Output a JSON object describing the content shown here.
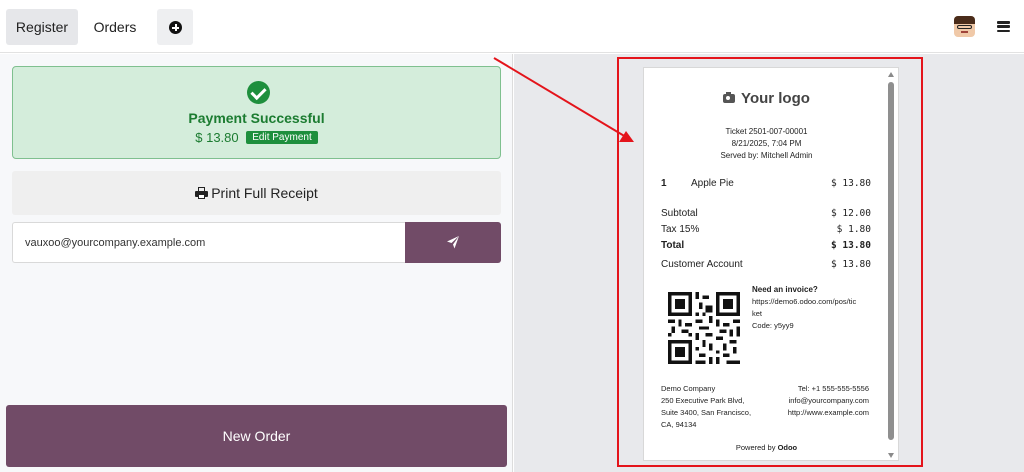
{
  "topbar": {
    "tabs": [
      {
        "label": "Register",
        "active": true
      },
      {
        "label": "Orders",
        "active": false
      }
    ],
    "add_icon": "plus-circle-icon",
    "avatar_icon": "user-avatar-icon",
    "menu_icon": "hamburger-menu-icon"
  },
  "payment": {
    "title": "Payment Successful",
    "amount": "$ 13.80",
    "edit_label": "Edit Payment",
    "status_color": "#1e8f3d"
  },
  "print": {
    "label": "Print Full Receipt"
  },
  "email": {
    "value": "vauxoo@yourcompany.example.com"
  },
  "new_order": {
    "label": "New Order"
  },
  "receipt": {
    "logo_text": "Your logo",
    "ticket": "Ticket 2501-007-00001",
    "datetime": "8/21/2025, 7:04 PM",
    "served_by": "Served by: Mitchell Admin",
    "lines": [
      {
        "qty": "1",
        "name": "Apple Pie",
        "price": "$ 13.80"
      }
    ],
    "subtotal_label": "Subtotal",
    "subtotal": "$ 12.00",
    "tax_label": "Tax 15%",
    "tax": "$ 1.80",
    "total_label": "Total",
    "total": "$ 13.80",
    "payment_label": "Customer Account",
    "payment_amount": "$ 13.80",
    "invoice_heading": "Need an invoice?",
    "invoice_url_1": "https://demo6.odoo.com/pos/tic",
    "invoice_url_2": "ket",
    "invoice_code": "Code: y5yy9",
    "company_name": "Demo Company",
    "company_addr_1": "250 Executive Park Blvd,",
    "company_addr_2": "Suite 3400, San Francisco,",
    "company_addr_3": "CA, 94134",
    "company_tel": "Tel: +1 555-555-5556",
    "company_email": "info@yourcompany.com",
    "company_web": "http://www.example.com",
    "powered_prefix": "Powered by ",
    "powered_brand": "Odoo"
  },
  "colors": {
    "primary": "#714b67",
    "success_bg": "#d4eddb",
    "annotation": "#e4141b"
  }
}
